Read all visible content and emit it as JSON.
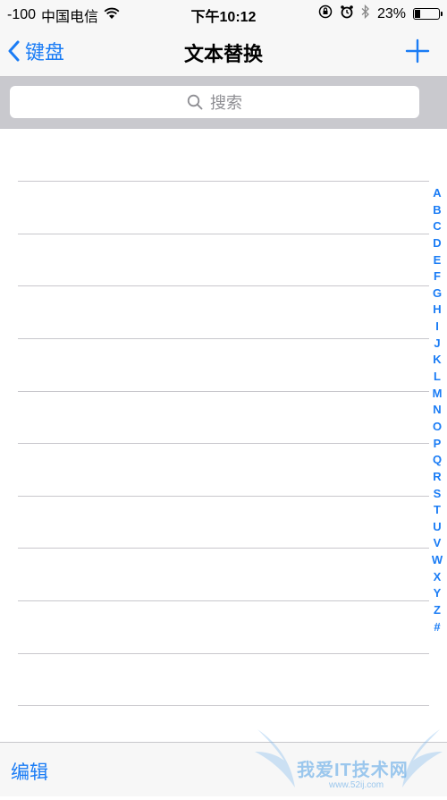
{
  "status_bar": {
    "signal": "-100",
    "carrier": "中国电信",
    "time": "下午10:12",
    "battery": "23%",
    "battery_level": 0.23
  },
  "nav": {
    "back_label": "键盘",
    "title": "文本替换"
  },
  "search": {
    "placeholder": "搜索"
  },
  "index_letters": [
    "A",
    "B",
    "C",
    "D",
    "E",
    "F",
    "G",
    "H",
    "I",
    "J",
    "K",
    "L",
    "M",
    "N",
    "O",
    "P",
    "Q",
    "R",
    "S",
    "T",
    "U",
    "V",
    "W",
    "X",
    "Y",
    "Z",
    "#"
  ],
  "toolbar": {
    "edit_label": "编辑"
  },
  "watermark": {
    "text": "我爱IT技术网",
    "url": "www.52ij.com"
  },
  "colors": {
    "accent": "#1a7cf5",
    "separator": "#c8c7cc",
    "search_bg": "#c9c9ce"
  }
}
